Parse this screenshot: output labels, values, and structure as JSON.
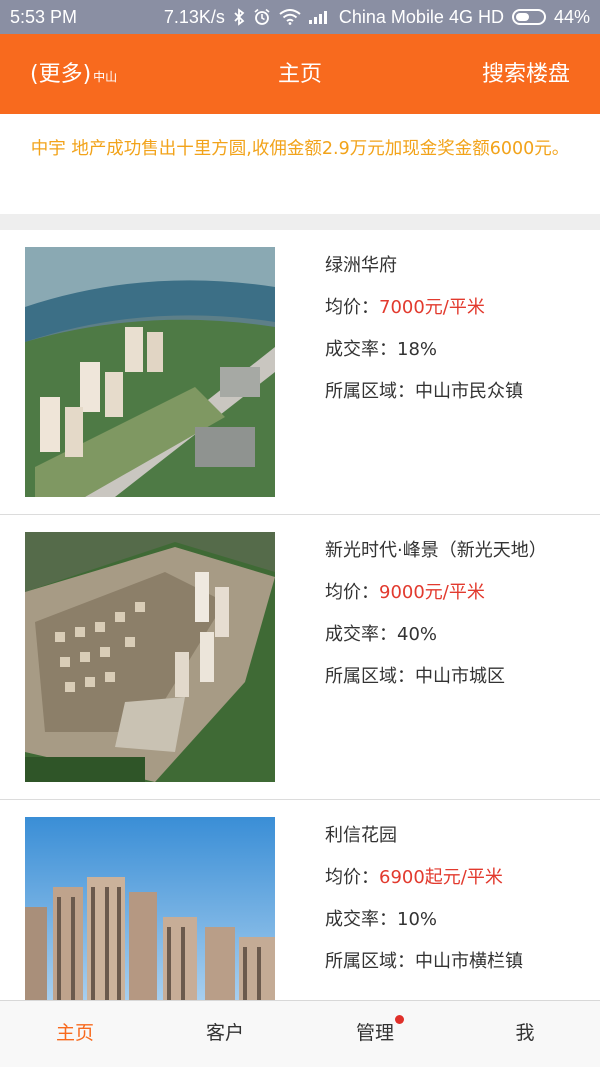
{
  "status_bar": {
    "time": "5:53 PM",
    "speed": "7.13K/s",
    "carrier": "China Mobile 4G HD",
    "battery": "44%"
  },
  "header": {
    "more_label": "(更多)",
    "city": "中山",
    "title": "主页",
    "search_label": "搜索楼盘",
    "accent_color": "#f86a1e"
  },
  "notice": {
    "text": "中宇 地产成功售出十里方圆,收佣金额2.9万元加现金奖金额6000元。"
  },
  "listings": [
    {
      "name": "绿洲华府",
      "price_label": "均价：",
      "price": "7000元/平米",
      "rate_label": "成交率：",
      "rate": "18%",
      "area_label": "所属区域：",
      "area": "中山市民众镇"
    },
    {
      "name": "新光时代·峰景（新光天地）",
      "price_label": "均价：",
      "price": "9000元/平米",
      "rate_label": "成交率：",
      "rate": "40%",
      "area_label": "所属区域：",
      "area": "中山市城区"
    },
    {
      "name": "利信花园",
      "price_label": "均价：",
      "price": "6900起元/平米",
      "rate_label": "成交率：",
      "rate": "10%",
      "area_label": "所属区域：",
      "area": "中山市横栏镇"
    }
  ],
  "tabs": [
    {
      "label": "主页"
    },
    {
      "label": "客户"
    },
    {
      "label": "管理"
    },
    {
      "label": "我"
    }
  ]
}
